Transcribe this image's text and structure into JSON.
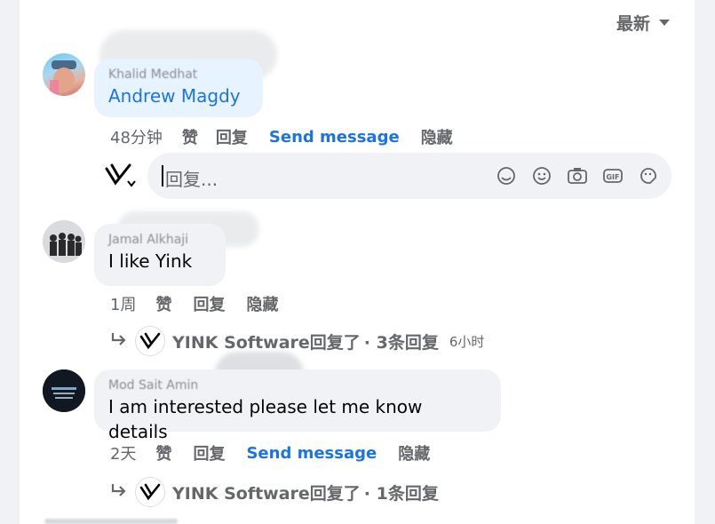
{
  "sort": {
    "label": "最新"
  },
  "comments": [
    {
      "author": "Khalid Medhat",
      "text": "Andrew Magdy",
      "time": "48分钟",
      "actions": {
        "like": "赞",
        "reply": "回复",
        "send_message": "Send message",
        "hide": "隐藏"
      }
    },
    {
      "author": "Jamal Alkhaji",
      "text": "I like Yink",
      "time": "1周",
      "actions": {
        "like": "赞",
        "reply": "回复",
        "hide": "隐藏"
      },
      "replies": {
        "page": "YINK Software回复了",
        "count": "· 3条回复",
        "time": "6小时"
      }
    },
    {
      "author": "Mod Sait Amin",
      "text": "I am interested please let me know details",
      "time": "2天",
      "actions": {
        "like": "赞",
        "reply": "回复",
        "send_message": "Send message",
        "hide": "隐藏"
      },
      "replies": {
        "page": "YINK Software回复了",
        "count": "· 1条回复"
      }
    }
  ],
  "composer": {
    "placeholder": "回复..."
  },
  "colors": {
    "link_blue": "#1b74e4",
    "secondary_text": "#65676b",
    "bubble_bg": "#f0f2f5"
  }
}
